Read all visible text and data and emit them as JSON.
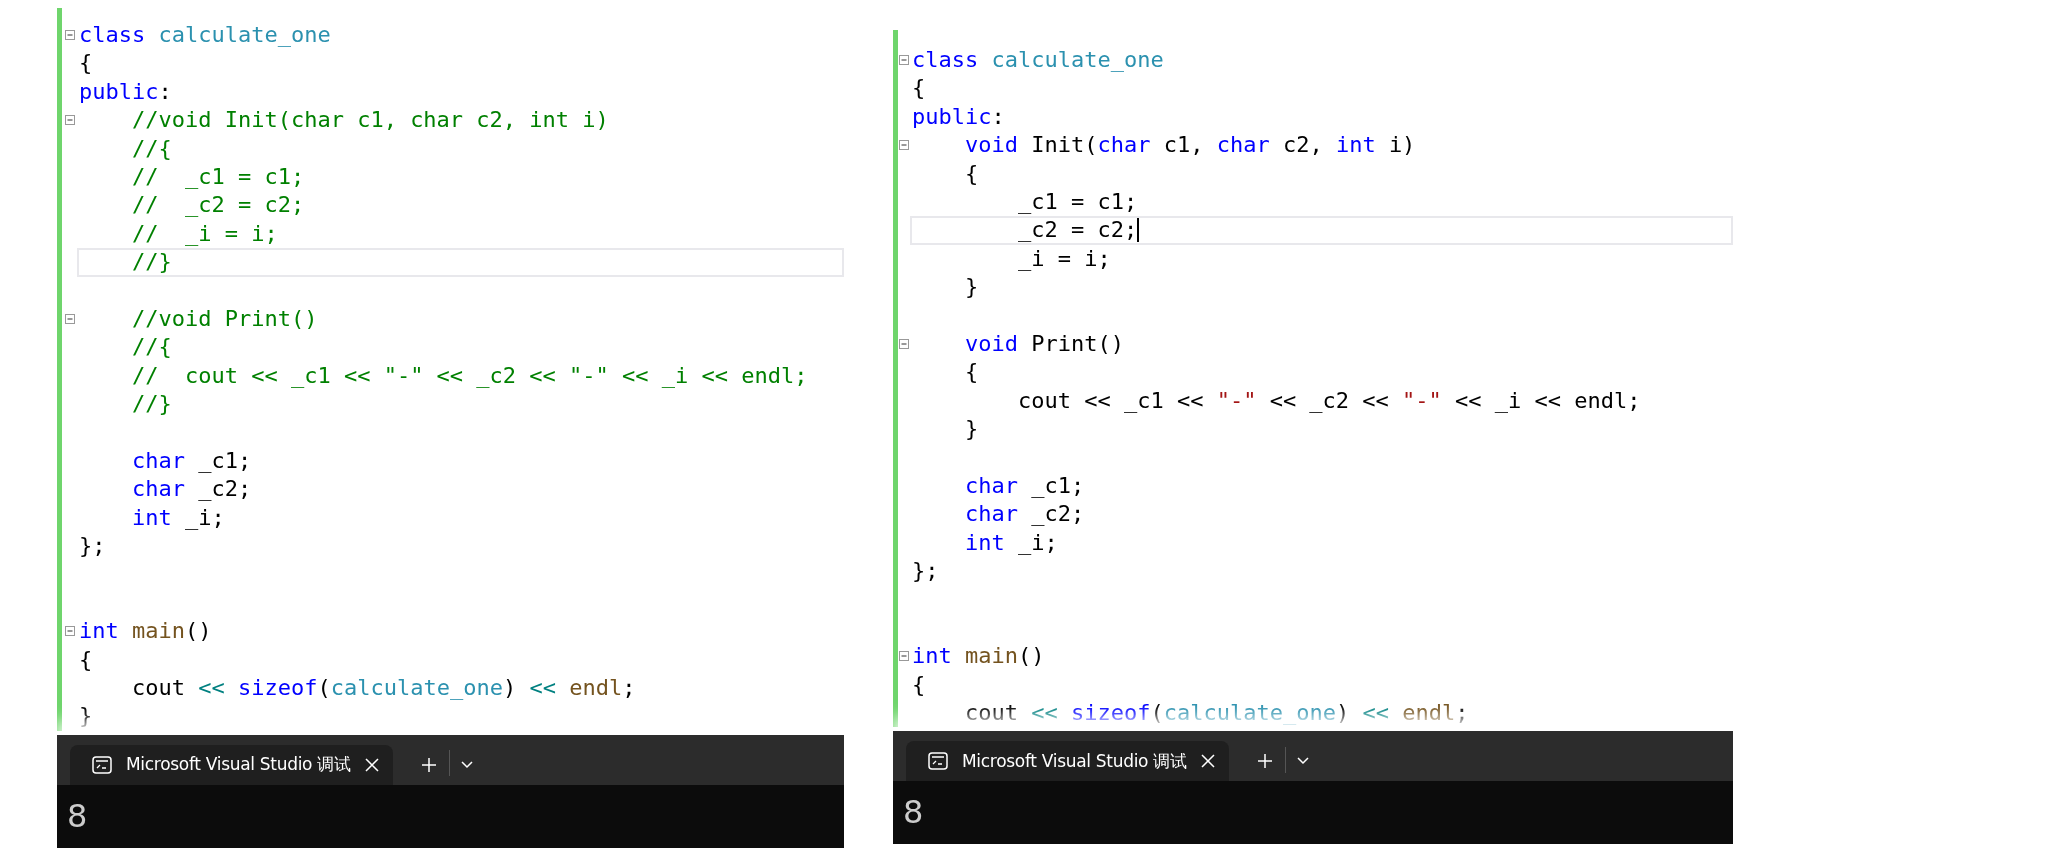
{
  "panels": [
    {
      "code": {
        "lines": [
          {
            "kind": "code",
            "fold": true,
            "tokens": [
              {
                "kind": "keyword",
                "text": "class "
              },
              {
                "kind": "type",
                "text": "calculate_one"
              }
            ]
          },
          {
            "kind": "code",
            "tokens": [
              {
                "kind": "plain",
                "text": "{"
              }
            ]
          },
          {
            "kind": "code",
            "tokens": [
              {
                "kind": "keyword",
                "text": "public"
              },
              {
                "kind": "plain",
                "text": ":"
              }
            ]
          },
          {
            "kind": "code",
            "fold": true,
            "tokens": [
              {
                "kind": "comment",
                "text": "    //void Init(char c1, char c2, int i)"
              }
            ]
          },
          {
            "kind": "code",
            "tokens": [
              {
                "kind": "comment",
                "text": "    //{"
              }
            ]
          },
          {
            "kind": "code",
            "tokens": [
              {
                "kind": "comment",
                "text": "    //  _c1 = c1;"
              }
            ]
          },
          {
            "kind": "code",
            "tokens": [
              {
                "kind": "comment",
                "text": "    //  _c2 = c2;"
              }
            ]
          },
          {
            "kind": "code",
            "tokens": [
              {
                "kind": "comment",
                "text": "    //  _i = i;"
              }
            ]
          },
          {
            "kind": "code",
            "current": true,
            "tokens": [
              {
                "kind": "comment",
                "text": "    //}"
              }
            ]
          },
          {
            "kind": "blank"
          },
          {
            "kind": "code",
            "fold": true,
            "tokens": [
              {
                "kind": "comment",
                "text": "    //void Print()"
              }
            ]
          },
          {
            "kind": "code",
            "tokens": [
              {
                "kind": "comment",
                "text": "    //{"
              }
            ]
          },
          {
            "kind": "code",
            "tokens": [
              {
                "kind": "comment",
                "text": "    //  cout << _c1 << \"-\" << _c2 << \"-\" << _i << endl;"
              }
            ]
          },
          {
            "kind": "code",
            "tokens": [
              {
                "kind": "comment",
                "text": "    //}"
              }
            ]
          },
          {
            "kind": "blank"
          },
          {
            "kind": "code",
            "tokens": [
              {
                "kind": "keyword",
                "text": "    char "
              },
              {
                "kind": "plain",
                "text": "_c1;"
              }
            ]
          },
          {
            "kind": "code",
            "tokens": [
              {
                "kind": "keyword",
                "text": "    char "
              },
              {
                "kind": "plain",
                "text": "_c2;"
              }
            ]
          },
          {
            "kind": "code",
            "tokens": [
              {
                "kind": "keyword",
                "text": "    int "
              },
              {
                "kind": "plain",
                "text": "_i;"
              }
            ]
          },
          {
            "kind": "code",
            "tokens": [
              {
                "kind": "plain",
                "text": "};"
              }
            ]
          },
          {
            "kind": "blank"
          },
          {
            "kind": "blank"
          },
          {
            "kind": "code",
            "fold": true,
            "tokens": [
              {
                "kind": "keyword",
                "text": "int "
              },
              {
                "kind": "function",
                "text": "main"
              },
              {
                "kind": "plain",
                "text": "()"
              }
            ]
          },
          {
            "kind": "code",
            "tokens": [
              {
                "kind": "plain",
                "text": "{"
              }
            ]
          },
          {
            "kind": "code",
            "tokens": [
              {
                "kind": "plain",
                "text": "    cout "
              },
              {
                "kind": "operator",
                "text": "<< "
              },
              {
                "kind": "keyword",
                "text": "sizeof"
              },
              {
                "kind": "plain",
                "text": "("
              },
              {
                "kind": "type",
                "text": "calculate_one"
              },
              {
                "kind": "plain",
                "text": ") "
              },
              {
                "kind": "operator",
                "text": "<< "
              },
              {
                "kind": "function",
                "text": "endl"
              },
              {
                "kind": "plain",
                "text": ";"
              }
            ]
          },
          {
            "kind": "code",
            "tokens": [
              {
                "kind": "plain",
                "text": "}"
              }
            ]
          }
        ]
      },
      "terminal": {
        "tab_title": "Microsoft Visual Studio 调试",
        "output": "8"
      }
    },
    {
      "code": {
        "lines": [
          {
            "kind": "code",
            "fold": true,
            "tokens": [
              {
                "kind": "keyword",
                "text": "class "
              },
              {
                "kind": "type",
                "text": "calculate_one"
              }
            ]
          },
          {
            "kind": "code",
            "tokens": [
              {
                "kind": "plain",
                "text": "{"
              }
            ]
          },
          {
            "kind": "code",
            "tokens": [
              {
                "kind": "keyword",
                "text": "public"
              },
              {
                "kind": "plain",
                "text": ":"
              }
            ]
          },
          {
            "kind": "code",
            "fold": true,
            "tokens": [
              {
                "kind": "keyword",
                "text": "    void "
              },
              {
                "kind": "plain",
                "text": "Init("
              },
              {
                "kind": "keyword",
                "text": "char "
              },
              {
                "kind": "plain",
                "text": "c1, "
              },
              {
                "kind": "keyword",
                "text": "char "
              },
              {
                "kind": "plain",
                "text": "c2, "
              },
              {
                "kind": "keyword",
                "text": "int "
              },
              {
                "kind": "plain",
                "text": "i)"
              }
            ]
          },
          {
            "kind": "code",
            "tokens": [
              {
                "kind": "plain",
                "text": "    {"
              }
            ]
          },
          {
            "kind": "code",
            "tokens": [
              {
                "kind": "plain",
                "text": "        _c1 = c1;"
              }
            ]
          },
          {
            "kind": "code",
            "current": true,
            "caret": true,
            "tokens": [
              {
                "kind": "plain",
                "text": "        _c2 = c2;"
              }
            ]
          },
          {
            "kind": "code",
            "tokens": [
              {
                "kind": "plain",
                "text": "        _i = i;"
              }
            ]
          },
          {
            "kind": "code",
            "tokens": [
              {
                "kind": "plain",
                "text": "    }"
              }
            ]
          },
          {
            "kind": "blank"
          },
          {
            "kind": "code",
            "fold": true,
            "tokens": [
              {
                "kind": "keyword",
                "text": "    void "
              },
              {
                "kind": "plain",
                "text": "Print()"
              }
            ]
          },
          {
            "kind": "code",
            "tokens": [
              {
                "kind": "plain",
                "text": "    {"
              }
            ]
          },
          {
            "kind": "code",
            "tokens": [
              {
                "kind": "plain",
                "text": "        cout << _c1 << "
              },
              {
                "kind": "string",
                "text": "\"-\""
              },
              {
                "kind": "plain",
                "text": " << _c2 << "
              },
              {
                "kind": "string",
                "text": "\"-\""
              },
              {
                "kind": "plain",
                "text": " << _i << endl;"
              }
            ]
          },
          {
            "kind": "code",
            "tokens": [
              {
                "kind": "plain",
                "text": "    }"
              }
            ]
          },
          {
            "kind": "blank"
          },
          {
            "kind": "code",
            "tokens": [
              {
                "kind": "keyword",
                "text": "    char "
              },
              {
                "kind": "plain",
                "text": "_c1;"
              }
            ]
          },
          {
            "kind": "code",
            "tokens": [
              {
                "kind": "keyword",
                "text": "    char "
              },
              {
                "kind": "plain",
                "text": "_c2;"
              }
            ]
          },
          {
            "kind": "code",
            "tokens": [
              {
                "kind": "keyword",
                "text": "    int "
              },
              {
                "kind": "plain",
                "text": "_i;"
              }
            ]
          },
          {
            "kind": "code",
            "tokens": [
              {
                "kind": "plain",
                "text": "};"
              }
            ]
          },
          {
            "kind": "blank"
          },
          {
            "kind": "blank"
          },
          {
            "kind": "code",
            "fold": true,
            "tokens": [
              {
                "kind": "keyword",
                "text": "int "
              },
              {
                "kind": "function",
                "text": "main"
              },
              {
                "kind": "plain",
                "text": "()"
              }
            ]
          },
          {
            "kind": "code",
            "tokens": [
              {
                "kind": "plain",
                "text": "{"
              }
            ]
          },
          {
            "kind": "code",
            "tokens": [
              {
                "kind": "plain",
                "text": "    cout "
              },
              {
                "kind": "operator",
                "text": "<< "
              },
              {
                "kind": "keyword",
                "text": "sizeof"
              },
              {
                "kind": "plain",
                "text": "("
              },
              {
                "kind": "type",
                "text": "calculate_one"
              },
              {
                "kind": "plain",
                "text": ") "
              },
              {
                "kind": "operator",
                "text": "<< "
              },
              {
                "kind": "function",
                "text": "endl"
              },
              {
                "kind": "plain",
                "text": ";"
              }
            ]
          }
        ]
      },
      "terminal": {
        "tab_title": "Microsoft Visual Studio 调试",
        "output": "8"
      }
    }
  ]
}
